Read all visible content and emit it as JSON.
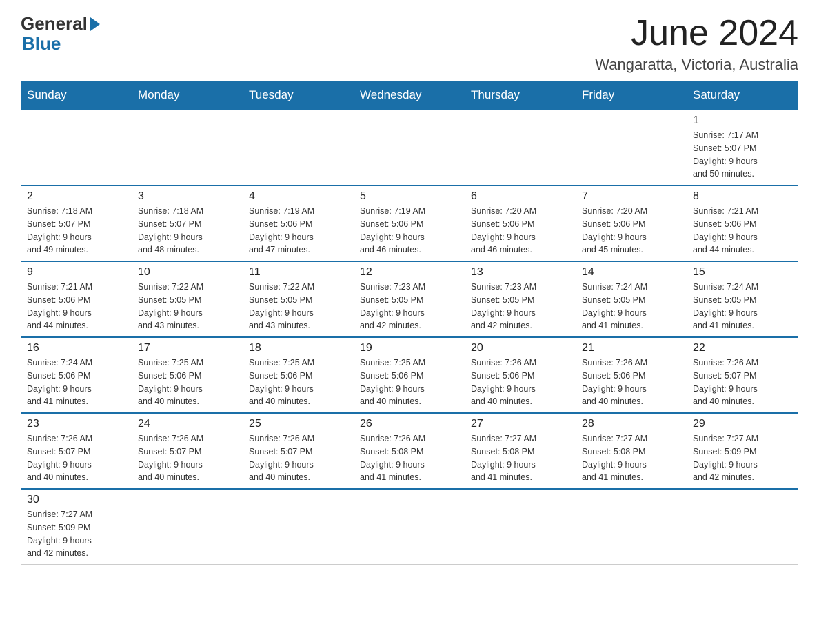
{
  "logo": {
    "general": "General",
    "blue": "Blue"
  },
  "title": "June 2024",
  "subtitle": "Wangaratta, Victoria, Australia",
  "days_of_week": [
    "Sunday",
    "Monday",
    "Tuesday",
    "Wednesday",
    "Thursday",
    "Friday",
    "Saturday"
  ],
  "weeks": [
    [
      {
        "day": "",
        "info": ""
      },
      {
        "day": "",
        "info": ""
      },
      {
        "day": "",
        "info": ""
      },
      {
        "day": "",
        "info": ""
      },
      {
        "day": "",
        "info": ""
      },
      {
        "day": "",
        "info": ""
      },
      {
        "day": "1",
        "info": "Sunrise: 7:17 AM\nSunset: 5:07 PM\nDaylight: 9 hours\nand 50 minutes."
      }
    ],
    [
      {
        "day": "2",
        "info": "Sunrise: 7:18 AM\nSunset: 5:07 PM\nDaylight: 9 hours\nand 49 minutes."
      },
      {
        "day": "3",
        "info": "Sunrise: 7:18 AM\nSunset: 5:07 PM\nDaylight: 9 hours\nand 48 minutes."
      },
      {
        "day": "4",
        "info": "Sunrise: 7:19 AM\nSunset: 5:06 PM\nDaylight: 9 hours\nand 47 minutes."
      },
      {
        "day": "5",
        "info": "Sunrise: 7:19 AM\nSunset: 5:06 PM\nDaylight: 9 hours\nand 46 minutes."
      },
      {
        "day": "6",
        "info": "Sunrise: 7:20 AM\nSunset: 5:06 PM\nDaylight: 9 hours\nand 46 minutes."
      },
      {
        "day": "7",
        "info": "Sunrise: 7:20 AM\nSunset: 5:06 PM\nDaylight: 9 hours\nand 45 minutes."
      },
      {
        "day": "8",
        "info": "Sunrise: 7:21 AM\nSunset: 5:06 PM\nDaylight: 9 hours\nand 44 minutes."
      }
    ],
    [
      {
        "day": "9",
        "info": "Sunrise: 7:21 AM\nSunset: 5:06 PM\nDaylight: 9 hours\nand 44 minutes."
      },
      {
        "day": "10",
        "info": "Sunrise: 7:22 AM\nSunset: 5:05 PM\nDaylight: 9 hours\nand 43 minutes."
      },
      {
        "day": "11",
        "info": "Sunrise: 7:22 AM\nSunset: 5:05 PM\nDaylight: 9 hours\nand 43 minutes."
      },
      {
        "day": "12",
        "info": "Sunrise: 7:23 AM\nSunset: 5:05 PM\nDaylight: 9 hours\nand 42 minutes."
      },
      {
        "day": "13",
        "info": "Sunrise: 7:23 AM\nSunset: 5:05 PM\nDaylight: 9 hours\nand 42 minutes."
      },
      {
        "day": "14",
        "info": "Sunrise: 7:24 AM\nSunset: 5:05 PM\nDaylight: 9 hours\nand 41 minutes."
      },
      {
        "day": "15",
        "info": "Sunrise: 7:24 AM\nSunset: 5:05 PM\nDaylight: 9 hours\nand 41 minutes."
      }
    ],
    [
      {
        "day": "16",
        "info": "Sunrise: 7:24 AM\nSunset: 5:06 PM\nDaylight: 9 hours\nand 41 minutes."
      },
      {
        "day": "17",
        "info": "Sunrise: 7:25 AM\nSunset: 5:06 PM\nDaylight: 9 hours\nand 40 minutes."
      },
      {
        "day": "18",
        "info": "Sunrise: 7:25 AM\nSunset: 5:06 PM\nDaylight: 9 hours\nand 40 minutes."
      },
      {
        "day": "19",
        "info": "Sunrise: 7:25 AM\nSunset: 5:06 PM\nDaylight: 9 hours\nand 40 minutes."
      },
      {
        "day": "20",
        "info": "Sunrise: 7:26 AM\nSunset: 5:06 PM\nDaylight: 9 hours\nand 40 minutes."
      },
      {
        "day": "21",
        "info": "Sunrise: 7:26 AM\nSunset: 5:06 PM\nDaylight: 9 hours\nand 40 minutes."
      },
      {
        "day": "22",
        "info": "Sunrise: 7:26 AM\nSunset: 5:07 PM\nDaylight: 9 hours\nand 40 minutes."
      }
    ],
    [
      {
        "day": "23",
        "info": "Sunrise: 7:26 AM\nSunset: 5:07 PM\nDaylight: 9 hours\nand 40 minutes."
      },
      {
        "day": "24",
        "info": "Sunrise: 7:26 AM\nSunset: 5:07 PM\nDaylight: 9 hours\nand 40 minutes."
      },
      {
        "day": "25",
        "info": "Sunrise: 7:26 AM\nSunset: 5:07 PM\nDaylight: 9 hours\nand 40 minutes."
      },
      {
        "day": "26",
        "info": "Sunrise: 7:26 AM\nSunset: 5:08 PM\nDaylight: 9 hours\nand 41 minutes."
      },
      {
        "day": "27",
        "info": "Sunrise: 7:27 AM\nSunset: 5:08 PM\nDaylight: 9 hours\nand 41 minutes."
      },
      {
        "day": "28",
        "info": "Sunrise: 7:27 AM\nSunset: 5:08 PM\nDaylight: 9 hours\nand 41 minutes."
      },
      {
        "day": "29",
        "info": "Sunrise: 7:27 AM\nSunset: 5:09 PM\nDaylight: 9 hours\nand 42 minutes."
      }
    ],
    [
      {
        "day": "30",
        "info": "Sunrise: 7:27 AM\nSunset: 5:09 PM\nDaylight: 9 hours\nand 42 minutes."
      },
      {
        "day": "",
        "info": ""
      },
      {
        "day": "",
        "info": ""
      },
      {
        "day": "",
        "info": ""
      },
      {
        "day": "",
        "info": ""
      },
      {
        "day": "",
        "info": ""
      },
      {
        "day": "",
        "info": ""
      }
    ]
  ]
}
